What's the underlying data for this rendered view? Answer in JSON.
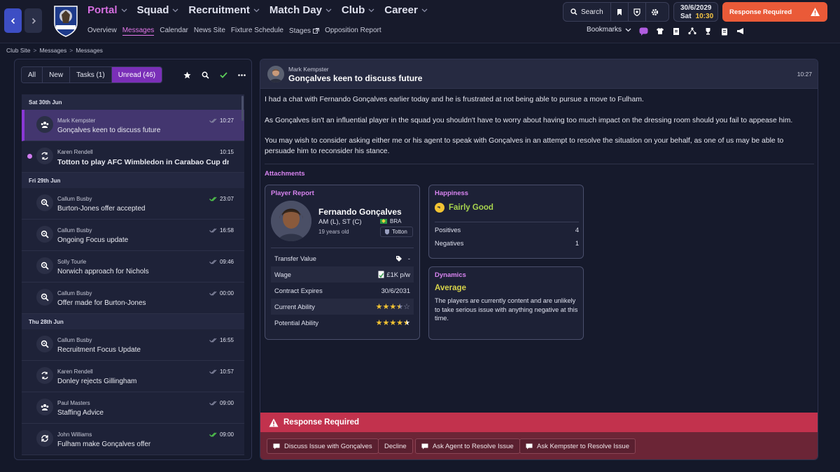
{
  "header": {
    "nav": [
      {
        "label": "Portal",
        "active": true
      },
      {
        "label": "Squad"
      },
      {
        "label": "Recruitment"
      },
      {
        "label": "Match Day"
      },
      {
        "label": "Club"
      },
      {
        "label": "Career"
      }
    ],
    "subnav": [
      "Overview",
      "Messages",
      "Calendar",
      "News Site",
      "Fixture Schedule",
      "Stages",
      "Opposition Report"
    ],
    "active_subnav": "Messages",
    "search_label": "Search",
    "date": "30/6/2029",
    "day": "Sat",
    "time": "10:30",
    "response_btn": "Response Required",
    "bookmarks_label": "Bookmarks",
    "crest_text": "BIG TOTTON",
    "colors": {
      "accent": "#d56ee0",
      "primary_btn": "#3d4ec4",
      "response": "#ea5a38",
      "time": "#f5c542"
    }
  },
  "breadcrumb": [
    "Club Site",
    "Messages",
    "Messages"
  ],
  "filters": [
    "All",
    "New",
    "Tasks (1)",
    "Unread (46)"
  ],
  "messages": [
    {
      "type": "day",
      "label": "Sat 30th Jun"
    },
    {
      "from": "Mark Kempster",
      "subject": "Gonçalves keen to discuss future",
      "time": "10:27",
      "icon": "group-icon",
      "selected": true,
      "check": "read"
    },
    {
      "from": "Karen Rendell",
      "subject": "Totton to play AFC Wimbledon in Carabao Cup dr...",
      "time": "10:15",
      "icon": "transfer-icon",
      "unread": true
    },
    {
      "type": "day",
      "label": "Fri 29th Jun"
    },
    {
      "from": "Callum Busby",
      "subject": "Burton-Jones offer accepted",
      "time": "23:07",
      "icon": "scout-icon",
      "check": "green"
    },
    {
      "from": "Callum Busby",
      "subject": "Ongoing Focus update",
      "time": "16:58",
      "icon": "scout-icon",
      "check": "read"
    },
    {
      "from": "Solly Tourle",
      "subject": "Norwich approach for Nichols",
      "time": "09:46",
      "icon": "scout-icon",
      "check": "read"
    },
    {
      "from": "Callum Busby",
      "subject": "Offer made for Burton-Jones",
      "time": "00:00",
      "icon": "scout-icon",
      "check": "read"
    },
    {
      "type": "day",
      "label": "Thu 28th Jun"
    },
    {
      "from": "Callum Busby",
      "subject": "Recruitment Focus Update",
      "time": "16:55",
      "icon": "scout-icon",
      "check": "read"
    },
    {
      "from": "Karen Rendell",
      "subject": "Donley rejects Gillingham",
      "time": "10:57",
      "icon": "transfer-icon",
      "check": "read"
    },
    {
      "from": "Paul Masters",
      "subject": "Staffing Advice",
      "time": "09:00",
      "icon": "group-icon",
      "check": "read"
    },
    {
      "from": "John Williams",
      "subject": "Fulham make Gonçalves offer",
      "time": "09:00",
      "icon": "refresh-icon",
      "check": "green"
    }
  ],
  "message": {
    "from": "Mark Kempster",
    "subject": "Gonçalves keen to discuss future",
    "time": "10:27",
    "paragraphs": [
      "I had a chat with Fernando Gonçalves earlier today and he is frustrated at not being able to pursue a move to Fulham.",
      "As Gonçalves isn't an influential player in the squad you shouldn't have to worry about having too much impact on the dressing room should you fail to appease him.",
      "You may wish to consider asking either me or his agent to speak with Gonçalves in an attempt to resolve the situation on your behalf, as one of us may be able to persuade him to reconsider his stance."
    ],
    "attachments_label": "Attachments"
  },
  "player_report": {
    "title": "Player Report",
    "name": "Fernando Gonçalves",
    "position": "AM (L), ST (C)",
    "age": "19 years old",
    "nationality": "BRA",
    "club": "Totton",
    "rows": [
      {
        "label": "Transfer Value",
        "value": "-"
      },
      {
        "label": "Wage",
        "value": "£1K p/w"
      },
      {
        "label": "Contract Expires",
        "value": "30/6/2031"
      },
      {
        "label": "Current Ability",
        "value": "",
        "stars": 3.5
      },
      {
        "label": "Potential Ability",
        "value": "",
        "stars": 4.5
      }
    ]
  },
  "happiness": {
    "title": "Happiness",
    "status": "Fairly Good",
    "positives_label": "Positives",
    "positives": "4",
    "negatives_label": "Negatives",
    "negatives": "1"
  },
  "dynamics": {
    "title": "Dynamics",
    "value": "Average",
    "description": "The players are currently content and are unlikely to take serious issue with anything negative at this time."
  },
  "response": {
    "title": "Response Required",
    "options": [
      "Discuss Issue with Gonçalves",
      "Decline",
      "Ask Agent to Resolve Issue",
      "Ask Kempster to Resolve Issue"
    ]
  }
}
